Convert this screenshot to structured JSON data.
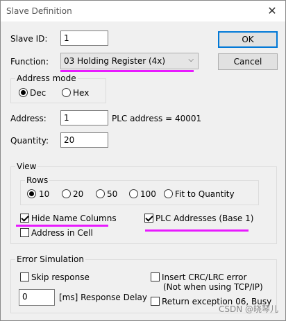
{
  "window": {
    "title": "Slave Definition",
    "close_icon": "close-icon"
  },
  "slave_id": {
    "label": "Slave ID:",
    "value": "1"
  },
  "function": {
    "label": "Function:",
    "value": "03 Holding Register (4x)"
  },
  "buttons": {
    "ok": "OK",
    "cancel": "Cancel"
  },
  "address_mode": {
    "legend": "Address mode",
    "dec": "Dec",
    "hex": "Hex",
    "selected": "Dec"
  },
  "address": {
    "label": "Address:",
    "value": "1",
    "plc_text": "PLC address = 40001"
  },
  "quantity": {
    "label": "Quantity:",
    "value": "20"
  },
  "view": {
    "legend": "View",
    "rows": {
      "legend": "Rows",
      "options": [
        "10",
        "20",
        "50",
        "100",
        "Fit to Quantity"
      ],
      "selected": "10"
    },
    "hide_name_columns": "Hide Name Columns",
    "plc_addresses": "PLC Addresses (Base 1)",
    "address_in_cell": "Address in Cell"
  },
  "error_simulation": {
    "legend": "Error Simulation",
    "skip_response": "Skip response",
    "delay_value": "0",
    "delay_label": "[ms] Response Delay",
    "insert_crc": "Insert CRC/LRC error",
    "insert_crc_note": "(Not when using TCP/IP)",
    "return_exception": "Return exception 06, Busy"
  },
  "watermark": "CSDN @晓琴儿",
  "colors": {
    "highlight": "#e81aff",
    "accent": "#0078d7"
  }
}
